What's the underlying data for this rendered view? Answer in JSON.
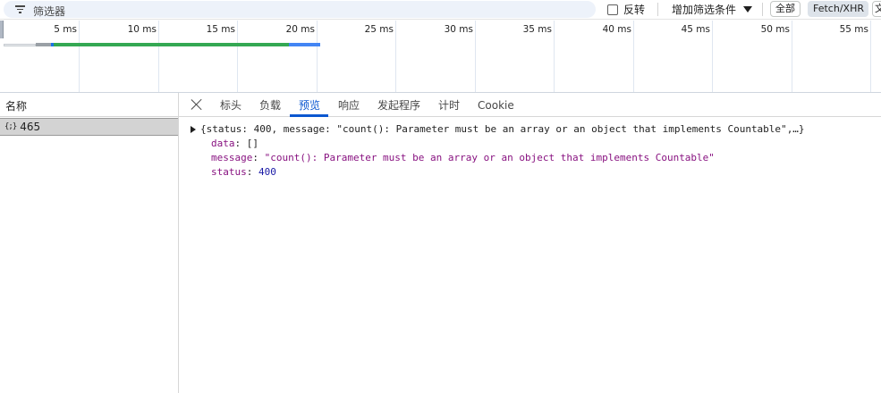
{
  "filterbar": {
    "placeholder": "筛选器",
    "invert_label": "反转",
    "more_filters_label": "增加筛选条件",
    "chips": [
      "全部",
      "Fetch/XHR",
      "文"
    ]
  },
  "overview": {
    "ticks": [
      "5 ms",
      "10 ms",
      "15 ms",
      "20 ms",
      "25 ms",
      "30 ms",
      "35 ms",
      "40 ms",
      "45 ms",
      "50 ms",
      "55 ms"
    ],
    "colors": {
      "waiting": "#9aa0a6",
      "ttfb": "#34a853",
      "download": "#4285f4"
    }
  },
  "requests": {
    "column_header": "名称",
    "rows": [
      {
        "icon": "{;}",
        "name": "465"
      }
    ]
  },
  "detail": {
    "tabs": [
      "标头",
      "负载",
      "预览",
      "响应",
      "发起程序",
      "计时",
      "Cookie"
    ],
    "active_tab": "预览",
    "preview": {
      "summary_open": "{",
      "k_status": "status",
      "v_status": "400",
      "k_message": "message",
      "v_message_short": "\"count(): Parameter must be an array or an object that implements Countable\"",
      "summary_tail": ",…}",
      "k_data": "data",
      "v_data": "[]",
      "v_message_full": "\"count(): Parameter must be an array or an object that implements Countable\""
    }
  }
}
